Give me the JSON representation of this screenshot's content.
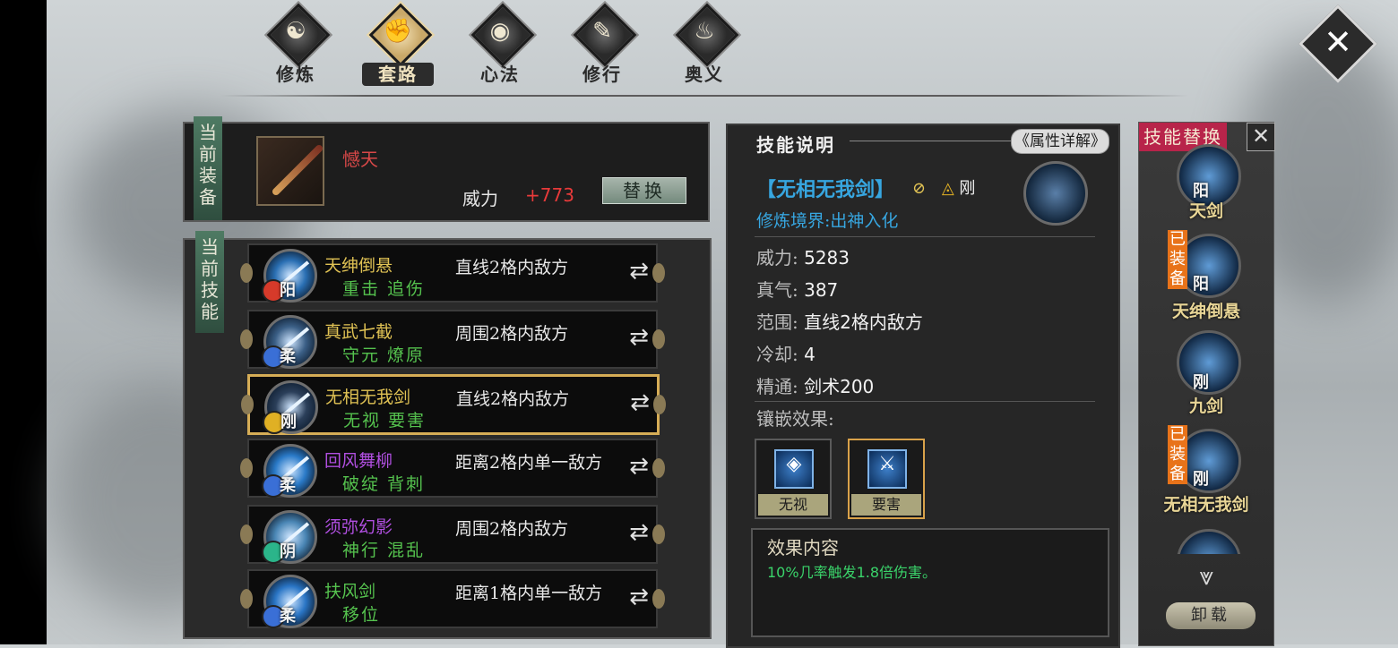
{
  "nav": {
    "tabs": [
      {
        "label": "修炼",
        "glyph": "☯"
      },
      {
        "label": "套路",
        "glyph": "✊"
      },
      {
        "label": "心法",
        "glyph": "◉"
      },
      {
        "label": "修行",
        "glyph": "✎"
      },
      {
        "label": "奥义",
        "glyph": "♨"
      }
    ],
    "active": "套路",
    "close_glyph": "✕"
  },
  "equipment": {
    "section_label": "当前装备",
    "item_name": "憾天",
    "power_label": "威力",
    "power_value": "+773",
    "swap_label": "替换"
  },
  "skills": {
    "section_label": "当前技能",
    "swap_glyph": "⇄",
    "rows": [
      {
        "name": "天绅倒悬",
        "name_color": "#e0c254",
        "tags": "重击 追伤",
        "range": "直线2格内敌方",
        "badge": "阳",
        "gem_color": "#d63a2a",
        "icon_bg": "#2a6fb3"
      },
      {
        "name": "真武七截",
        "name_color": "#e0c254",
        "tags": "守元 燎原",
        "range": "周围2格内敌方",
        "badge": "柔",
        "gem_color": "#3a6fd6",
        "icon_bg": "#3b5f86"
      },
      {
        "name": "无相无我剑",
        "name_color": "#e0c254",
        "tags": "无视 要害",
        "range": "直线2格内敌方",
        "badge": "刚",
        "gem_color": "#e0b024",
        "icon_bg": "#2b3f5a"
      },
      {
        "name": "回风舞柳",
        "name_color": "#b04fe0",
        "tags": "破绽 背刺",
        "range": "距离2格内单一敌方",
        "badge": "柔",
        "gem_color": "#3a6fd6",
        "icon_bg": "#2a7ac8"
      },
      {
        "name": "须弥幻影",
        "name_color": "#b04fe0",
        "tags": "神行 混乱",
        "range": "周围2格内敌方",
        "badge": "阴",
        "gem_color": "#2bb58a",
        "icon_bg": "#4a86b5"
      },
      {
        "name": "扶风剑",
        "name_color": "#55c24e",
        "tags": "移位",
        "range": "距离1格内单一敌方",
        "badge": "柔",
        "gem_color": "#3a6fd6",
        "icon_bg": "#2a75c5"
      }
    ]
  },
  "description": {
    "title": "技能说明",
    "attr_button": "《属性详解》",
    "skill_title": "【无相无我剑】",
    "realm": "修炼境界:出神入化",
    "badge": "刚",
    "stats": [
      {
        "label": "威力:",
        "value": "5283"
      },
      {
        "label": "真气:",
        "value": "387"
      },
      {
        "label": "范围:",
        "value": "直线2格内敌方"
      },
      {
        "label": "冷却:",
        "value": "4"
      },
      {
        "label": "精通:",
        "value": "剑术200"
      }
    ],
    "inlay_label": "镶嵌效果:",
    "inlays": [
      {
        "name": "无视",
        "glyph": "◈"
      },
      {
        "name": "要害",
        "glyph": "⚔"
      }
    ],
    "effect_title": "效果内容",
    "effect_text": "10%几率触发1.8倍伤害。"
  },
  "swap_panel": {
    "title": "技能替换",
    "close_glyph": "✕",
    "unload_label": "卸载",
    "down_glyph": "⩔",
    "equipped_label": "已装备",
    "items": [
      {
        "name": "天剑",
        "badge": "阳",
        "equipped": false
      },
      {
        "name": "天绅倒悬",
        "badge": "阳",
        "equipped": true
      },
      {
        "name": "九剑",
        "badge": "刚",
        "equipped": false
      },
      {
        "name": "无相无我剑",
        "badge": "刚",
        "equipped": true
      }
    ]
  }
}
